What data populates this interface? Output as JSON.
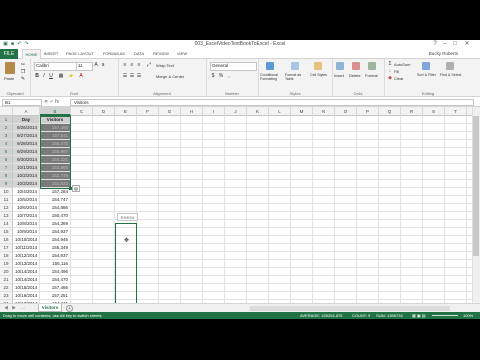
{
  "window": {
    "title": "003_ExcelVideoTextBookToExcel - Excel",
    "user": "Bucky Roberts",
    "controls": [
      "?",
      "–",
      "□",
      "✕"
    ]
  },
  "ribbon_tabs": [
    "FILE",
    "HOME",
    "INSERT",
    "PAGE LAYOUT",
    "FORMULAS",
    "DATA",
    "REVIEW",
    "VIEW"
  ],
  "ribbon": {
    "paste_label": "Paste",
    "font_name": "Calibri",
    "font_size": "11",
    "wrap_text": "Wrap Text",
    "merge_center": "Merge & Center",
    "number_format": "General",
    "conditional_formatting": "Conditional Formatting",
    "format_as_table": "Format as Table",
    "cell_styles": "Cell Styles",
    "insert": "Insert",
    "delete": "Delete",
    "format": "Format",
    "autosum": "AutoSum",
    "fill": "Fill",
    "clear": "Clear",
    "sort_filter": "Sort & Filter",
    "find_select": "Find & Select",
    "groups": [
      "Clipboard",
      "Font",
      "Alignment",
      "Number",
      "Styles",
      "Cells",
      "Editing"
    ]
  },
  "formula_bar": {
    "name_box": "B1",
    "formula": "Visitors"
  },
  "columns": [
    "A",
    "B",
    "C",
    "D",
    "E",
    "F",
    "G",
    "H",
    "I",
    "J",
    "K",
    "L",
    "M",
    "N",
    "O",
    "P",
    "Q",
    "R",
    "S",
    "T",
    "U"
  ],
  "rows": [
    {
      "n": "1",
      "a": "Day",
      "b": "Visitors"
    },
    {
      "n": "2",
      "a": "9/26/2014",
      "b": "157,485"
    },
    {
      "n": "3",
      "a": "9/27/2014",
      "b": "157,611"
    },
    {
      "n": "4",
      "a": "9/28/2014",
      "b": "156,478"
    },
    {
      "n": "5",
      "a": "9/29/2014",
      "b": "155,987"
    },
    {
      "n": "6",
      "a": "9/30/2014",
      "b": "154,321"
    },
    {
      "n": "7",
      "a": "10/1/2014",
      "b": "153,969"
    },
    {
      "n": "8",
      "a": "10/2/2014",
      "b": "152,749"
    },
    {
      "n": "9",
      "a": "10/3/2014",
      "b": "151,633"
    },
    {
      "n": "10",
      "a": "10/4/2014",
      "b": "157,284"
    },
    {
      "n": "11",
      "a": "10/5/2014",
      "b": "154,747"
    },
    {
      "n": "12",
      "a": "10/6/2014",
      "b": "154,886"
    },
    {
      "n": "13",
      "a": "10/7/2014",
      "b": "150,470"
    },
    {
      "n": "14",
      "a": "10/8/2014",
      "b": "154,369"
    },
    {
      "n": "15",
      "a": "10/9/2014",
      "b": "154,937"
    },
    {
      "n": "16",
      "a": "10/10/2014",
      "b": "154,946"
    },
    {
      "n": "17",
      "a": "10/11/2014",
      "b": "155,349"
    },
    {
      "n": "18",
      "a": "10/12/2014",
      "b": "154,937"
    },
    {
      "n": "19",
      "a": "10/13/2014",
      "b": "155,116"
    },
    {
      "n": "20",
      "a": "10/14/2014",
      "b": "154,496"
    },
    {
      "n": "21",
      "a": "10/14/2014",
      "b": "154,470"
    },
    {
      "n": "22",
      "a": "10/15/2014",
      "b": "157,466"
    },
    {
      "n": "23",
      "a": "10/16/2014",
      "b": "157,251"
    },
    {
      "n": "24",
      "a": "10/17/2014",
      "b": "154,211"
    }
  ],
  "drag_tooltip": "E9:E24",
  "sheet_tab": "Visitors",
  "status": {
    "message": "Drag to move cell contents, use Alt key to switch sheets",
    "average": "AVERAGE: 155204.875",
    "count": "COUNT: 9",
    "sum": "SUM: 1396734",
    "zoom": "100%"
  }
}
